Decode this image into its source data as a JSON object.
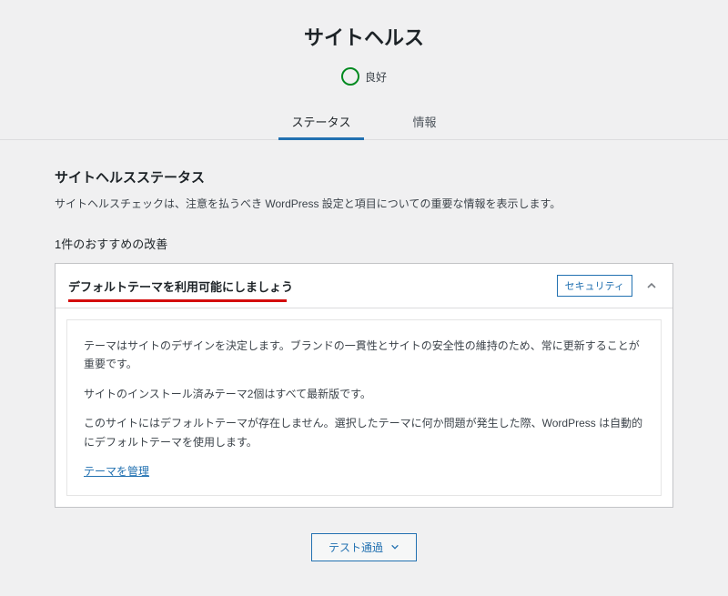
{
  "header": {
    "title": "サイトヘルス",
    "status_label": "良好"
  },
  "tabs": {
    "status": "ステータス",
    "info": "情報"
  },
  "section": {
    "title": "サイトヘルスステータス",
    "desc": "サイトヘルスチェックは、注意を払うべき WordPress 設定と項目についての重要な情報を表示します。"
  },
  "improvements": {
    "heading": "1件のおすすめの改善",
    "items": [
      {
        "title": "デフォルトテーマを利用可能にしましょう",
        "badge": "セキュリティ",
        "body_p1": "テーマはサイトのデザインを決定します。ブランドの一貫性とサイトの安全性の維持のため、常に更新することが重要です。",
        "body_p2": "サイトのインストール済みテーマ2個はすべて最新版です。",
        "body_p3": "このサイトにはデフォルトテーマが存在しません。選択したテーマに何か問題が発生した際、WordPress は自動的にデフォルトテーマを使用します。",
        "link": "テーマを管理"
      }
    ]
  },
  "footer": {
    "test_passed_label": "テスト通過"
  }
}
